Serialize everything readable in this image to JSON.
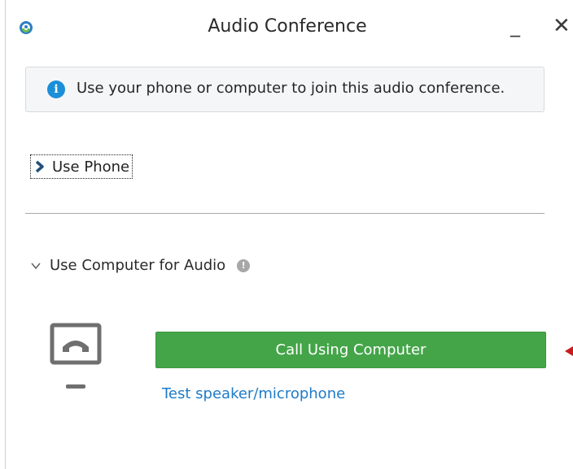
{
  "window": {
    "title": "Audio Conference",
    "minimize_label": "_",
    "close_label": "✕"
  },
  "info": {
    "icon": "info-icon",
    "text": "Use your phone or computer to join this audio conference."
  },
  "use_phone": {
    "label": "Use Phone",
    "expanded": false
  },
  "use_computer": {
    "label": "Use Computer for Audio",
    "expanded": true,
    "help_icon": "help-icon",
    "call_button_label": "Call Using Computer",
    "test_link_label": "Test speaker/microphone"
  },
  "colors": {
    "accent_green": "#44a548",
    "link_blue": "#1e7bc9",
    "info_blue": "#1b8fd8",
    "annotation_red": "#cc1a1a"
  }
}
